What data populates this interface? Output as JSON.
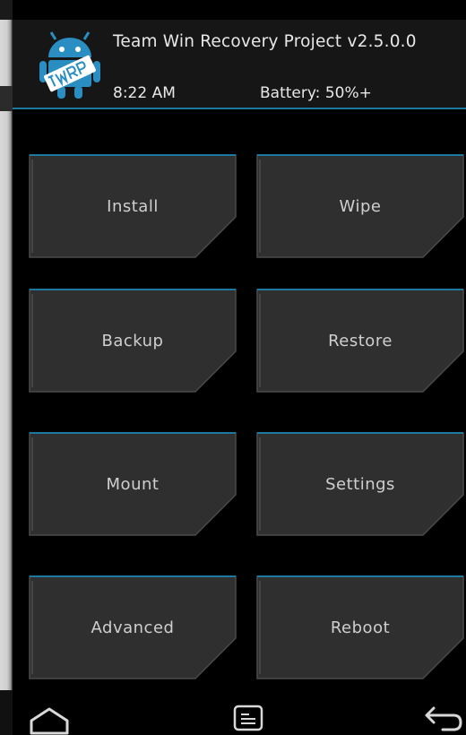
{
  "header": {
    "title": "Team Win Recovery Project  v2.5.0.0",
    "time": "8:22 AM",
    "battery": "Battery: 50%+"
  },
  "menu": {
    "buttons": [
      {
        "label": "Install"
      },
      {
        "label": "Wipe"
      },
      {
        "label": "Backup"
      },
      {
        "label": "Restore"
      },
      {
        "label": "Mount"
      },
      {
        "label": "Settings"
      },
      {
        "label": "Advanced"
      },
      {
        "label": "Reboot"
      }
    ]
  },
  "navbar": {
    "icons": [
      "home-icon",
      "console-icon",
      "back-icon"
    ]
  },
  "colors": {
    "accent": "#1c7aa0",
    "tile_fill": "#2f2f2f",
    "background": "#000000",
    "text": "#e8e8e8"
  }
}
